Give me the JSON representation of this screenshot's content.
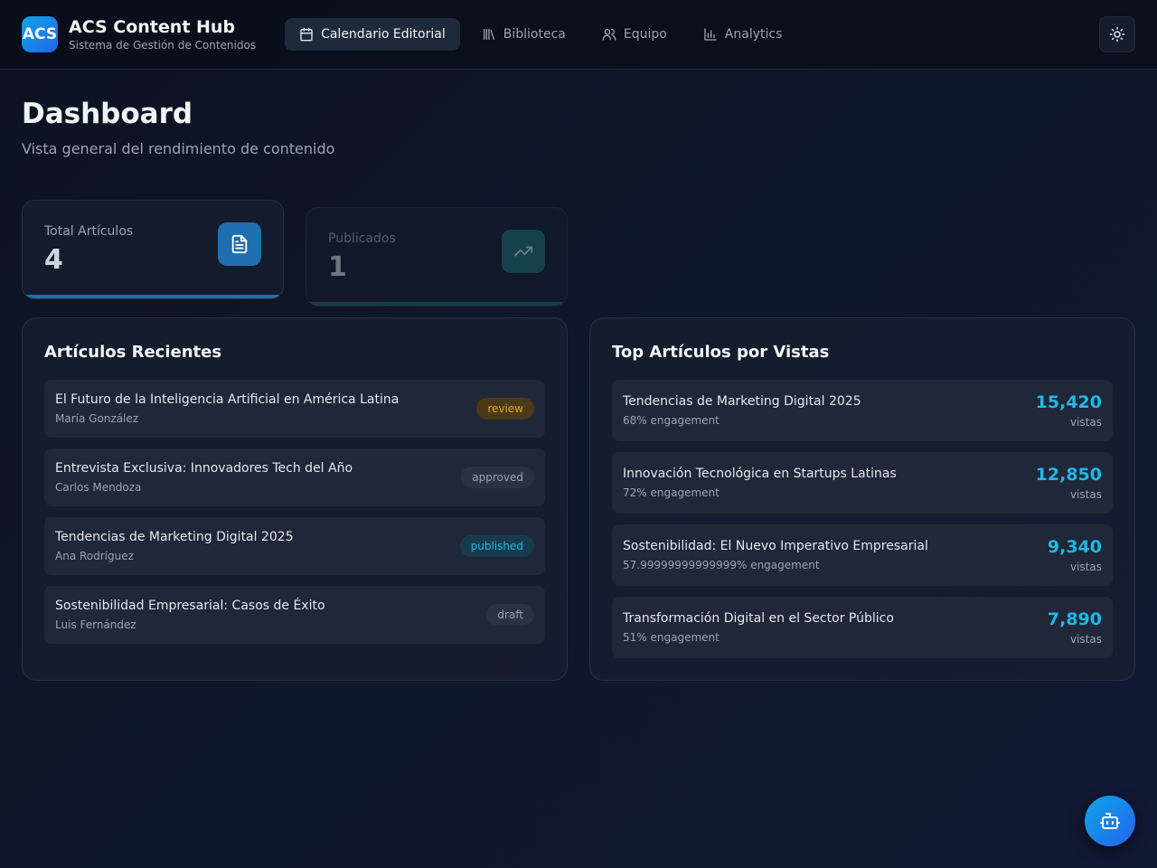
{
  "header": {
    "logo_text": "ACS",
    "title": "ACS Content Hub",
    "subtitle": "Sistema de Gestión de Contenidos",
    "nav": [
      {
        "label": "Calendario Editorial",
        "icon": "calendar-icon",
        "active": true
      },
      {
        "label": "Biblioteca",
        "icon": "library-icon",
        "active": false
      },
      {
        "label": "Equipo",
        "icon": "users-icon",
        "active": false
      },
      {
        "label": "Analytics",
        "icon": "bar-chart-icon",
        "active": false
      }
    ],
    "theme_icon": "sun-icon"
  },
  "page": {
    "title": "Dashboard",
    "subtitle": "Vista general del rendimiento de contenido"
  },
  "stats": [
    {
      "label": "Total Artículos",
      "value": "4",
      "icon": "document-icon",
      "color": "#1d6fb0"
    },
    {
      "label": "Publicados",
      "value": "1",
      "icon": "trending-up-icon",
      "color": "#1e6b70"
    }
  ],
  "recent": {
    "title": "Artículos Recientes",
    "items": [
      {
        "title": "El Futuro de la Inteligencia Artificial en América Latina",
        "author": "María González",
        "status": "review"
      },
      {
        "title": "Entrevista Exclusiva: Innovadores Tech del Año",
        "author": "Carlos Mendoza",
        "status": "approved"
      },
      {
        "title": "Tendencias de Marketing Digital 2025",
        "author": "Ana Rodríguez",
        "status": "published"
      },
      {
        "title": "Sostenibilidad Empresarial: Casos de Éxito",
        "author": "Luis Fernández",
        "status": "draft"
      }
    ]
  },
  "top": {
    "title": "Top Artículos por Vistas",
    "items": [
      {
        "title": "Tendencias de Marketing Digital 2025",
        "engagement": "68% engagement",
        "views": "15,420",
        "unit": "vistas"
      },
      {
        "title": "Innovación Tecnológica en Startups Latinas",
        "engagement": "72% engagement",
        "views": "12,850",
        "unit": "vistas"
      },
      {
        "title": "Sostenibilidad: El Nuevo Imperativo Empresarial",
        "engagement": "57.99999999999999% engagement",
        "views": "9,340",
        "unit": "vistas"
      },
      {
        "title": "Transformación Digital en el Sector Público",
        "engagement": "51% engagement",
        "views": "7,890",
        "unit": "vistas"
      }
    ]
  },
  "colors": {
    "accent": "#22b7e6",
    "review": "#e0a526",
    "approved": "#9ca3af",
    "published": "#22b7e6",
    "draft": "#9ca3af"
  },
  "fab_icon": "bot-icon"
}
